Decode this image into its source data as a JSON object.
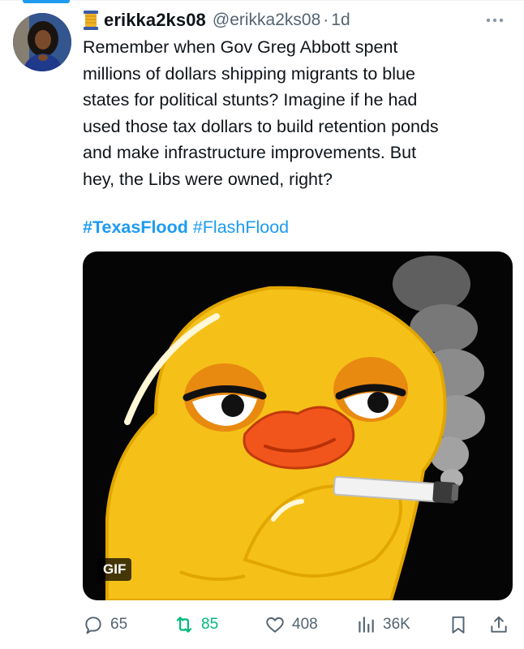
{
  "tweet": {
    "author": {
      "display_name": "erikka2ks08",
      "handle": "@erikka2ks08",
      "badge_icon": "thread-spool-icon"
    },
    "separator": "·",
    "time_ago": "1d",
    "menu_icon": "more-dots-icon",
    "text": "Remember when Gov Greg Abbott spent\nmillions of dollars shipping migrants to blue\nstates for political stunts? Imagine if he had\nused those tax dollars to build retention ponds\nand make infrastructure improvements. But\nhey, the Libs were owned, right?",
    "hashtags": [
      "#TexasFlood",
      "#FlashFlood"
    ],
    "media": {
      "type_badge": "GIF",
      "icon": "smoking-duck-gif"
    },
    "actions": {
      "replies": "65",
      "reposts": "85",
      "likes": "408",
      "views": "36K"
    }
  },
  "colors": {
    "accent": "#1d9bf0",
    "repost_active": "#00ba7c",
    "muted": "#536471",
    "text": "#0f1419"
  }
}
